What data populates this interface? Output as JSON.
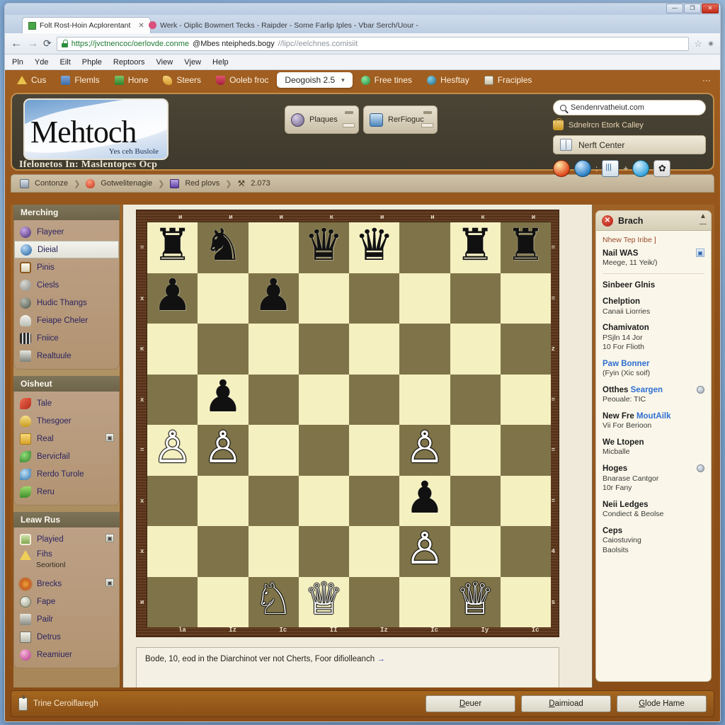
{
  "window": {
    "buttons": {
      "minimize": "—",
      "maximize": "❐",
      "close": "✕"
    }
  },
  "tabs": [
    {
      "title": "Folt Rost-Hoin Acplorentant",
      "close": "✕",
      "icon": "grid-icon",
      "active": true
    },
    {
      "title": "Werk - Oiplic Bowmert Tecks - Raipder - Some Farlip Iples - Vbar Serch/Uour -",
      "icon": "bookmark-icon",
      "active": false
    }
  ],
  "toolbar": {
    "back": "←",
    "forward": "→",
    "reload": "⟳",
    "url_secure": "https;//jvctnencoc/oerlovde.conme",
    "url_main": "@Mbes nteipheds.bogy",
    "url_rest": "//lipc//eelchnes.comisiit",
    "star": "☆",
    "wrench": "✷"
  },
  "browser_menu": [
    "Pln",
    "Yde",
    "Eilt",
    "Phple",
    "Reptoors",
    "View",
    "Vjew",
    "Help"
  ],
  "site_nav": {
    "items": [
      {
        "label": "Cus",
        "icon": "triangle-icon"
      },
      {
        "label": "Flemls",
        "icon": "photo-icon"
      },
      {
        "label": "Hone",
        "icon": "green-square-icon"
      },
      {
        "label": "Steers",
        "icon": "gold-ribbon-icon"
      },
      {
        "label": "Ooleb froc",
        "icon": "red-flower-icon"
      }
    ],
    "selected": {
      "label": "Deogoish 2.5",
      "caret": "▾"
    },
    "items_after": [
      {
        "label": "Free tines",
        "icon": "emerald-icon"
      },
      {
        "label": "Hesftay",
        "icon": "teal-globe-icon"
      },
      {
        "label": "Fraciples",
        "icon": "clipboard-icon"
      }
    ],
    "overflow": "⋮"
  },
  "site_header": {
    "logo_word": "Mehtoch",
    "logo_sub": "Yes ceh Buslole",
    "tagline": "Ifelonetos In: Maslentopes Ocp",
    "buttons": [
      {
        "label": "Plaques",
        "icon": "medal-icon"
      },
      {
        "label": "RerFioguc",
        "icon": "book-icon"
      }
    ],
    "search": {
      "value": "Sendenrvatheiut.com",
      "icon": "search-icon"
    },
    "search_link": {
      "label": "Sdnelrcn Etork Calley",
      "icon": "bag-icon"
    },
    "nerf_box": {
      "label": "Nerft Center",
      "icon": "book-panel-icon"
    },
    "icon_row": [
      {
        "name": "orange-ball-icon"
      },
      {
        "name": "blue-ball-icon"
      },
      {
        "sep": ":"
      },
      {
        "name": "chart-icon"
      },
      {
        "sep": "+"
      },
      {
        "name": "shirt-icon"
      },
      {
        "name": "gear-icon"
      }
    ]
  },
  "breadcrumb": [
    {
      "label": "Contonze",
      "icon": "monitor-icon"
    },
    {
      "label": "Gotwelitenagie",
      "icon": "flame-icon"
    },
    {
      "label": "Red plovs",
      "icon": "purple-window-icon"
    },
    {
      "label": "2.073",
      "icon": "wrench-icon"
    }
  ],
  "left_sidebar": {
    "groups": [
      {
        "title": "Merching",
        "items": [
          {
            "label": "Flayeer",
            "icon": "i-purple",
            "selected": false
          },
          {
            "label": "Dieial",
            "icon": "i-blue",
            "selected": true
          },
          {
            "label": "Pinis",
            "icon": "i-note",
            "selected": false
          },
          {
            "label": "Ciesls",
            "icon": "i-gray",
            "selected": false
          },
          {
            "label": "Hudic Thangs",
            "icon": "i-dgray",
            "selected": false
          },
          {
            "label": "Feiape Cheler",
            "icon": "i-cloud",
            "selected": false
          },
          {
            "label": "Fniice",
            "icon": "i-film",
            "selected": false
          },
          {
            "label": "Realtuule",
            "icon": "i-print",
            "selected": false
          }
        ]
      },
      {
        "title": "Oisheut",
        "items": [
          {
            "label": "Tale",
            "icon": "i-redbird"
          },
          {
            "label": "Thesgoer",
            "icon": "i-yellow"
          },
          {
            "label": "Real",
            "icon": "i-folder",
            "badge": "▣"
          },
          {
            "label": "Bervicfail",
            "icon": "i-leaf"
          },
          {
            "label": "Rerdo Turole",
            "icon": "i-water"
          },
          {
            "label": "Reru",
            "icon": "i-sprout"
          }
        ]
      },
      {
        "title": "Leaw Rus",
        "items": [
          {
            "label": "Playied",
            "icon": "i-pic",
            "badge": "▣"
          },
          {
            "label": "Fihs",
            "sublabel": "Seortionl",
            "icon": "i-warn"
          },
          {
            "label": "Brecks",
            "icon": "i-star",
            "badge": "▣"
          },
          {
            "label": "Fape",
            "icon": "i-globe"
          },
          {
            "label": "Pailr",
            "icon": "i-tower"
          },
          {
            "label": "Detrus",
            "icon": "i-doc"
          },
          {
            "label": "Reamiuer",
            "icon": "i-pink"
          }
        ]
      }
    ]
  },
  "chess": {
    "file_labels": [
      "la",
      "Iz",
      "Ic",
      "II",
      "Iz",
      "Ic",
      "Iy",
      "Ic"
    ],
    "file_labels_top": [
      "и",
      "и",
      "и",
      "к",
      "и",
      "и",
      "к",
      "и"
    ],
    "rank_labels": [
      "=",
      "x",
      "к",
      "x",
      "=",
      "x",
      "x",
      "и"
    ],
    "rank_labels_right": [
      "=",
      "=",
      "z",
      "=",
      "=",
      "=",
      "4",
      "s"
    ],
    "light_color": "#f5f0c0",
    "dark_color": "#7f7449",
    "frame_color": "#5d361a",
    "board": [
      [
        "r",
        "n",
        "",
        "q",
        "q",
        "",
        "r",
        "r"
      ],
      [
        "p",
        "",
        "p",
        "",
        "",
        "",
        "",
        ""
      ],
      [
        "",
        "",
        "",
        "",
        "",
        "",
        "",
        ""
      ],
      [
        "",
        "p",
        "",
        "",
        "",
        "",
        "",
        ""
      ],
      [
        "P",
        "P",
        "",
        "",
        "",
        "P",
        "",
        ""
      ],
      [
        "",
        "",
        "",
        "",
        "",
        "p",
        "",
        ""
      ],
      [
        "",
        "",
        "",
        "",
        "",
        "P",
        "",
        ""
      ],
      [
        "",
        "",
        "N",
        "Q",
        "",
        "",
        "Q",
        ""
      ]
    ],
    "status": "Bode, 10, eod in the Diarchinot ver not Cherts, Foor difiolleanch",
    "status_arrow": "→"
  },
  "right_panel": {
    "header": {
      "title": "Brach",
      "close": "✕",
      "collapse": "▲",
      "minimize": "—"
    },
    "note": "Nhew Tep Iribe ]",
    "items": [
      {
        "title": "Nail WAS",
        "sub": "Meege, 11 Yeik/)",
        "flag": "▣",
        "rule": true
      },
      {
        "title": "Sinbeer Glnis",
        "sub": ""
      },
      {
        "title": "Chelption",
        "sub": "Canaii Liorries"
      },
      {
        "title": "Chamivaton",
        "sub": "PSjln 14 Jor",
        "sub2": "10 For Flioth"
      },
      {
        "title": "Paw Bonner",
        "sub": "(Fyin (Xic soif)",
        "blue": true
      },
      {
        "title": "Otthes ",
        "title_link": "Seargen",
        "sub": "Peouale: TIC",
        "dot": true
      },
      {
        "title": "New Fre ",
        "title_link": "MoutAilk",
        "sub": "Vii For Berioon"
      },
      {
        "title": "We Ltopen",
        "sub": "Micballe"
      },
      {
        "title": "Hoges",
        "sub": "Bnarase Cantgor",
        "sub2": "10r Fany",
        "dot": true
      },
      {
        "title": "Neii Ledges",
        "sub": "Condiect & Beolse"
      },
      {
        "title": "Ceps",
        "sub": "Caiostuving",
        "sub2": "Baolsits"
      }
    ]
  },
  "footer": {
    "left_label": "Trine Ceroiflaregh",
    "buttons": [
      {
        "label": "Deuer",
        "accel": "D"
      },
      {
        "label": "Daimioad",
        "accel": "D"
      },
      {
        "label": "Glode Hame",
        "accel": "G"
      }
    ]
  }
}
